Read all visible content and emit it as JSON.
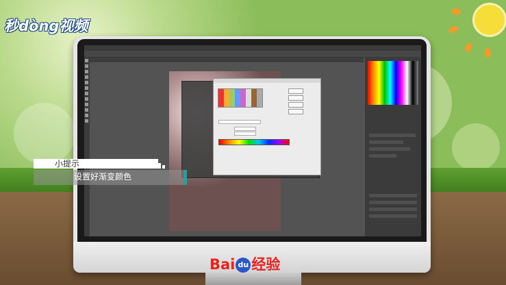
{
  "logo": {
    "text": "秒dòng视频"
  },
  "tip": {
    "title": "小提示",
    "text": "设置好渐变颜色"
  },
  "baidu": {
    "bai": "Bai",
    "du": "du",
    "jingyan": "经验"
  },
  "colors": {
    "accent_teal": "#1aa5a0",
    "baidu_red": "#e52420",
    "baidu_blue": "#2a56c6"
  }
}
